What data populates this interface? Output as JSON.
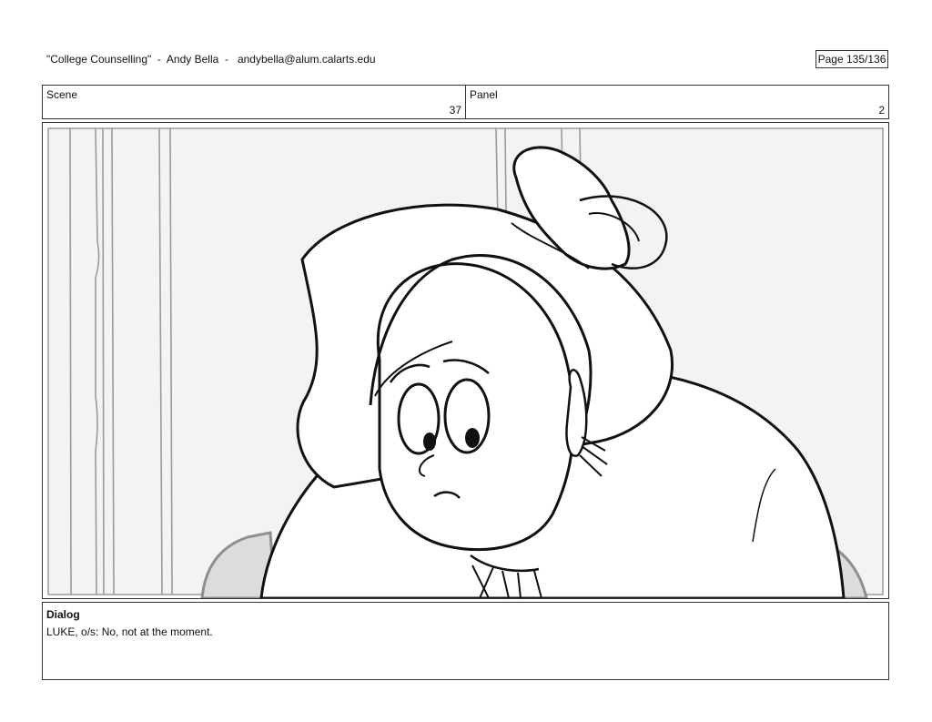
{
  "header": {
    "title": "\"College Counselling\"  -  Andy Bella  -   andybella@alum.calarts.edu",
    "page": "Page 135/136"
  },
  "scene": {
    "label": "Scene",
    "value": "37"
  },
  "panel": {
    "label": "Panel",
    "value": "2"
  },
  "dialog": {
    "label": "Dialog",
    "text": "LUKE, o/s: No, not at the moment."
  }
}
